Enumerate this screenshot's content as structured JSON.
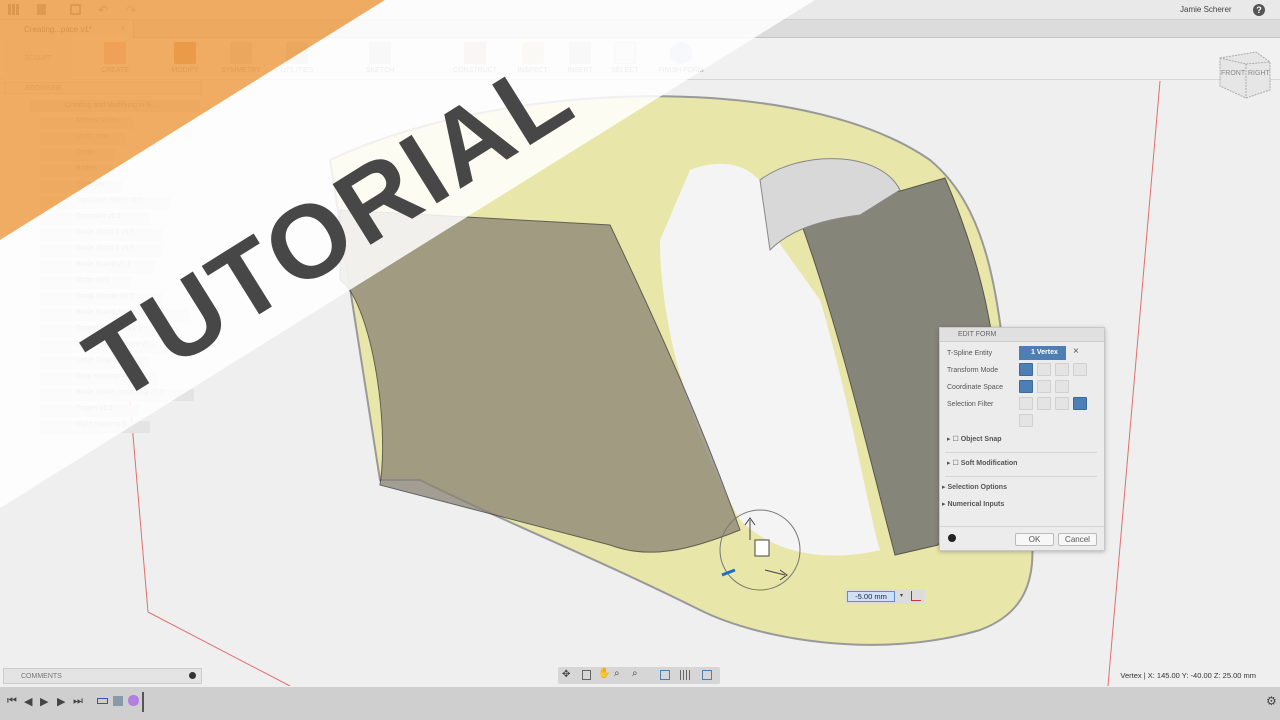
{
  "topbar": {
    "user": "Jamie Scherer",
    "help": "?"
  },
  "tab": {
    "title": "Creating...pace v1*",
    "close": "×"
  },
  "toolbar": {
    "workspace": "SCULPT",
    "groups": [
      "CREATE",
      "MODIFY",
      "SYMMETRY",
      "UTILITIES",
      "SKETCH",
      "CONSTRUCT",
      "INSPECT",
      "INSERT",
      "SELECT",
      "FINISH FORM"
    ]
  },
  "browser": {
    "title": "BROWSER",
    "root": "Creating and Modifying in S...",
    "items": [
      "Named Views",
      "Units: mm",
      "Origin",
      "Bodies",
      "Sketches",
      "Top Cover Sheet v1:1",
      "Controller v1:1",
      "Guide Block 1 v1:1",
      "Guide Block 2 v1:1",
      "Blade Guard v1:1",
      "Motor v1:1",
      "Small Spindle v1:1",
      "Blade Guard Assembly v1:1",
      "Connecting Rod v1:1",
      "Gear Housing Cover v1:1",
      "Large Gear v1:1",
      "Gear Housing v2:1",
      "Blade Holder Assembly v1:1",
      "Trigger v1:1",
      "Right Housing:1"
    ]
  },
  "viewcube": {
    "front": "FRONT",
    "right": "RIGHT"
  },
  "edit_form": {
    "title": "EDIT FORM",
    "tspline_label": "T-Spline Entity",
    "tspline_value": "1 Vertex",
    "transform_label": "Transform Mode",
    "coord_label": "Coordinate Space",
    "filter_label": "Selection Filter",
    "object_snap": "Object Snap",
    "soft_mod": "Soft Modification",
    "selection_options": "Selection Options",
    "numerical_inputs": "Numerical Inputs",
    "ok": "OK",
    "cancel": "Cancel"
  },
  "numeric_input": {
    "value": "-5.00 mm"
  },
  "comments": {
    "label": "COMMENTS"
  },
  "status": {
    "text": "Vertex | X: 145.00 Y: -40.00 Z: 25.00 mm"
  },
  "banner": {
    "text": "TUTORIAL"
  },
  "colors": {
    "banner_orange": "#f0a04a",
    "selection_blue": "#4d7fb4",
    "model_yellow": "#e8e6a8"
  }
}
